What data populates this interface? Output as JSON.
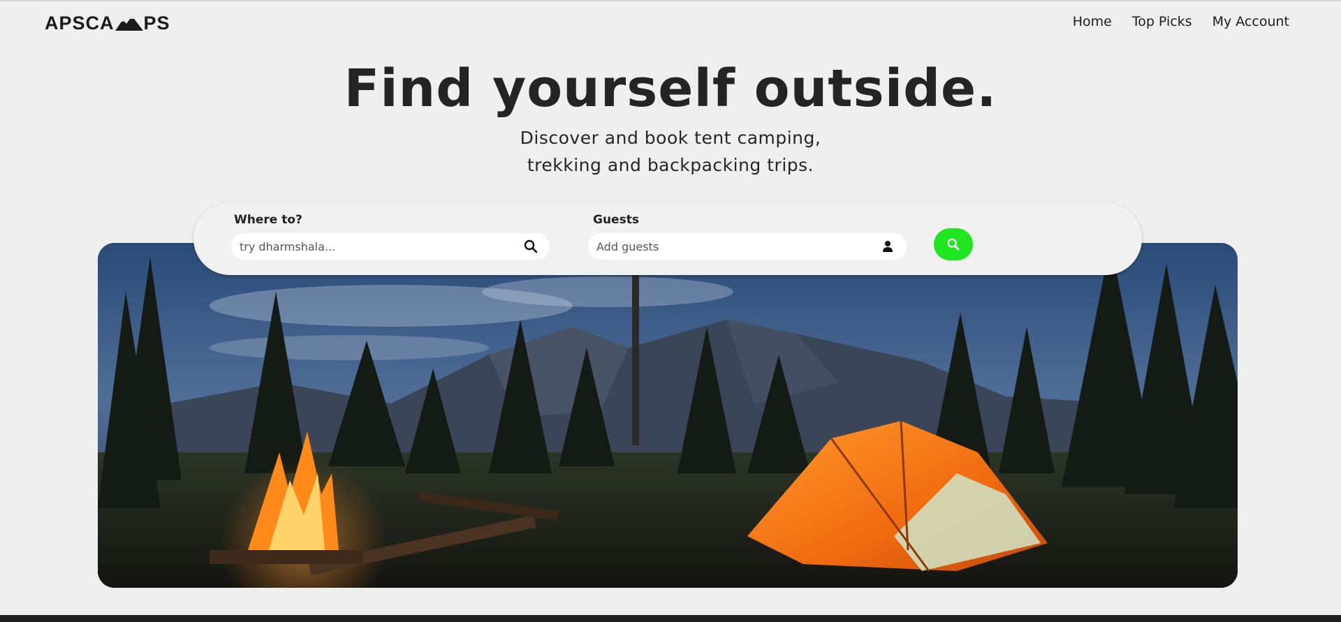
{
  "brand": {
    "logo_text_left": "APSCA",
    "logo_text_right": "PS",
    "logo_icon": "mountains-icon"
  },
  "nav": {
    "items": [
      "Home",
      "Top Picks",
      "My Account"
    ]
  },
  "hero": {
    "title": "Find yourself outside.",
    "subtitle_line1": "Discover and book tent camping,",
    "subtitle_line2": "trekking and backpacking trips."
  },
  "search": {
    "where_label": "Where to?",
    "where_placeholder": "try dharmshala...",
    "where_icon": "search-icon",
    "guests_label": "Guests",
    "guests_placeholder": "Add guests",
    "guests_icon": "user-icon",
    "submit_icon": "search-icon",
    "submit_color": "#1fe61f"
  },
  "hero_image": {
    "alt": "campsite-photo"
  }
}
